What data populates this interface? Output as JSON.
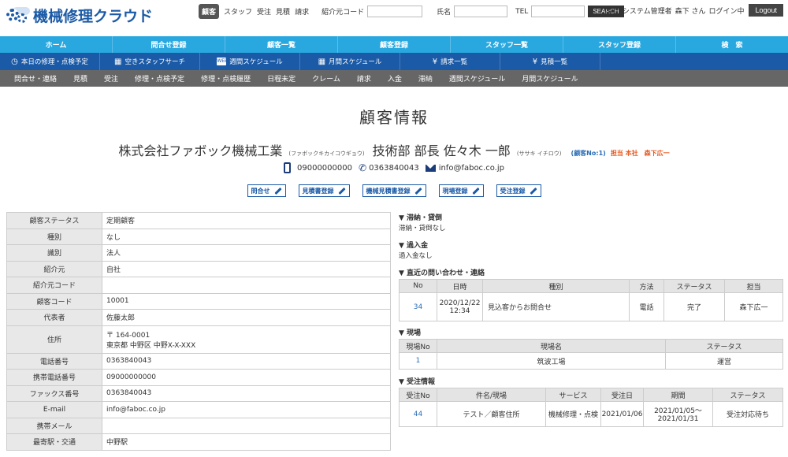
{
  "header": {
    "logo": "機械修理クラウド",
    "active_tab": "顧客",
    "nav_links": [
      "スタッフ",
      "受注",
      "見積",
      "請求"
    ],
    "search": {
      "introducer_label": "紹介元コード",
      "name_label": "氏名",
      "tel_label": "TEL",
      "button": "SEARCH"
    },
    "user": {
      "office": "本社",
      "role": "システム管理者",
      "name": "森下 さん",
      "status": "ログイン中",
      "logout": "Logout"
    }
  },
  "nav_main": [
    "ホーム",
    "問合せ登録",
    "顧客一覧",
    "顧客登録",
    "スタッフ一覧",
    "スタッフ登録",
    "検　索"
  ],
  "nav_sub": [
    {
      "label": "本日の修理・点検予定",
      "icon": "clock-icon"
    },
    {
      "label": "空きスタッフサーチ",
      "icon": "calendar-icon"
    },
    {
      "label": "週間スケジュール",
      "icon": "week-icon"
    },
    {
      "label": "月間スケジュール",
      "icon": "grid-calendar-icon"
    },
    {
      "label": "請求一覧",
      "icon": "yen-icon"
    },
    {
      "label": "見積一覧",
      "icon": "yen-icon"
    }
  ],
  "nav_tertiary": [
    "問合せ・連絡",
    "見積",
    "受注",
    "修理・点検予定",
    "修理・点検履歴",
    "日程未定",
    "クレーム",
    "請求",
    "入金",
    "滞納",
    "週間スケジュール",
    "月間スケジュール"
  ],
  "page": {
    "title": "顧客情報",
    "company": "株式会社ファボック機械工業",
    "company_kana": "(ファボックキカイコウギョウ)",
    "person": "技術部 部長 佐々木 一郎",
    "person_kana": "(ササキ イチロウ)",
    "customer_no": "(顧客No:1)",
    "tanto": "担当 本社　森下広一",
    "mobile": "09000000000",
    "tel": "0363840043",
    "email": "info@faboc.co.jp",
    "actions": [
      "問合せ",
      "見積書登録",
      "機械見積書登録",
      "現場登録",
      "受注登録"
    ]
  },
  "detail_rows": [
    {
      "k": "顧客ステータス",
      "v": "定期顧客"
    },
    {
      "k": "種別",
      "v": "なし"
    },
    {
      "k": "識別",
      "v": "法人"
    },
    {
      "k": "紹介元",
      "v": "自社"
    },
    {
      "k": "紹介元コード",
      "v": ""
    },
    {
      "k": "顧客コード",
      "v": "10001"
    },
    {
      "k": "代表者",
      "v": "佐藤太郎"
    },
    {
      "k": "住所",
      "v": "〒 164-0001",
      "v2": "東京都 中野区 中野X-X-XXX"
    },
    {
      "k": "電話番号",
      "v": "0363840043"
    },
    {
      "k": "携帯電話番号",
      "v": "09000000000"
    },
    {
      "k": "ファックス番号",
      "v": "0363840043"
    },
    {
      "k": "E-mail",
      "v": "info@faboc.co.jp"
    },
    {
      "k": "携帯メール",
      "v": ""
    },
    {
      "k": "最寄駅・交通",
      "v": "中野駅"
    }
  ],
  "right": {
    "arrears": {
      "title": "▼ 滞納・貸倒",
      "note": "滞納・貸倒なし"
    },
    "overpay": {
      "title": "▼ 過入金",
      "note": "過入金なし"
    },
    "inquiries": {
      "title": "▼ 直近の問い合わせ・連絡",
      "headers": [
        "No",
        "日時",
        "種別",
        "方法",
        "ステータス",
        "担当"
      ],
      "rows": [
        {
          "no": "34",
          "date": "2020/12/22",
          "time": "12:34",
          "type": "見込客からお問合せ",
          "method": "電話",
          "status": "完了",
          "tanto": "森下広一"
        }
      ]
    },
    "sites": {
      "title": "▼ 現場",
      "headers": [
        "現場No",
        "現場名",
        "ステータス"
      ],
      "rows": [
        {
          "no": "1",
          "name": "筑波工場",
          "status": "運営"
        }
      ]
    },
    "orders": {
      "title": "▼ 受注情報",
      "headers": [
        "受注No",
        "件名/現場",
        "サービス",
        "受注日",
        "期間",
        "ステータス"
      ],
      "rows": [
        {
          "no": "44",
          "name": "テスト／顧客住所",
          "service": "機械修理・点検",
          "date": "2021/01/06",
          "period1": "2021/01/05～",
          "period2": "2021/01/31",
          "status": "受注対応待ち"
        }
      ]
    }
  }
}
